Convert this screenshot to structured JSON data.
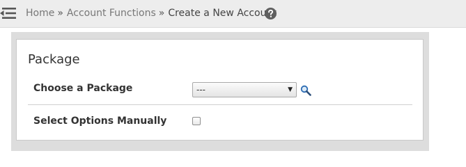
{
  "breadcrumb": {
    "items": [
      "Home",
      "Account Functions"
    ],
    "separator": "»",
    "current": "Create a New Account"
  },
  "icons": {
    "menu": "menu-collapse-icon",
    "help": "help-icon",
    "search": "search-icon"
  },
  "package_section": {
    "title": "Package",
    "choose_label": "Choose a Package",
    "select_value": "---",
    "manual_label": "Select Options Manually",
    "manual_checked": false
  },
  "colors": {
    "topbar_bg": "#ededed",
    "help_icon": "#606060"
  }
}
